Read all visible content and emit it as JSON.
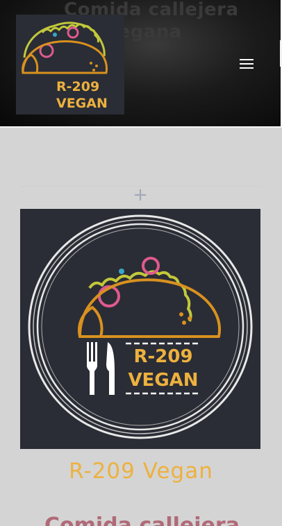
{
  "header": {
    "hero_line1": "Comida callejera",
    "hero_line2": "vegana",
    "logo_text_line1": "R-209",
    "logo_text_line2": "VEGAN",
    "menu_icon": "hamburger-menu-icon"
  },
  "content": {
    "add_icon": "plus-icon",
    "add_symbol": "+",
    "image_text_line1": "R-209",
    "image_text_line2": "VEGAN",
    "restaurant_name": "R-209 Vegan",
    "section_heading": "Comida callejera"
  },
  "colors": {
    "accent_yellow": "#edb13f",
    "logo_bg": "#2a2d35",
    "heading_pink": "#b06a78"
  }
}
